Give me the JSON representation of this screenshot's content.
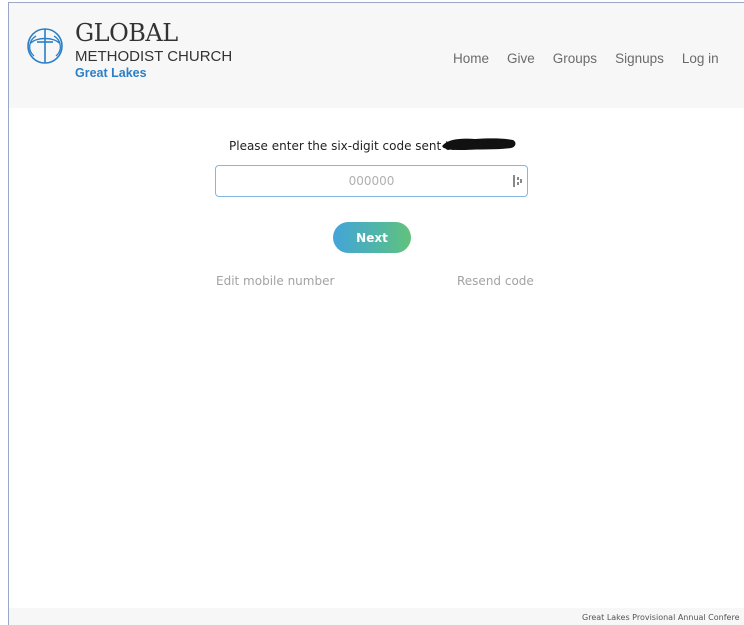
{
  "brand": {
    "line1": "GLOBAL",
    "line2": "METHODIST CHURCH",
    "line3": "Great Lakes",
    "accent_color": "#2a7fc6"
  },
  "nav": {
    "items": [
      {
        "label": "Home"
      },
      {
        "label": "Give"
      },
      {
        "label": "Groups"
      },
      {
        "label": "Signups"
      },
      {
        "label": "Log in"
      }
    ]
  },
  "verify": {
    "prompt": "Please enter the six-digit code sent to",
    "redacted": true,
    "code_placeholder": "000000",
    "code_value": "",
    "input_icon": "password-manager-icon",
    "next_label": "Next",
    "edit_label": "Edit mobile number",
    "resend_label": "Resend code",
    "button_gradient": [
      "#44a4d9",
      "#62c27a"
    ]
  },
  "footer": {
    "text": "Great Lakes Provisional Annual Confere"
  }
}
